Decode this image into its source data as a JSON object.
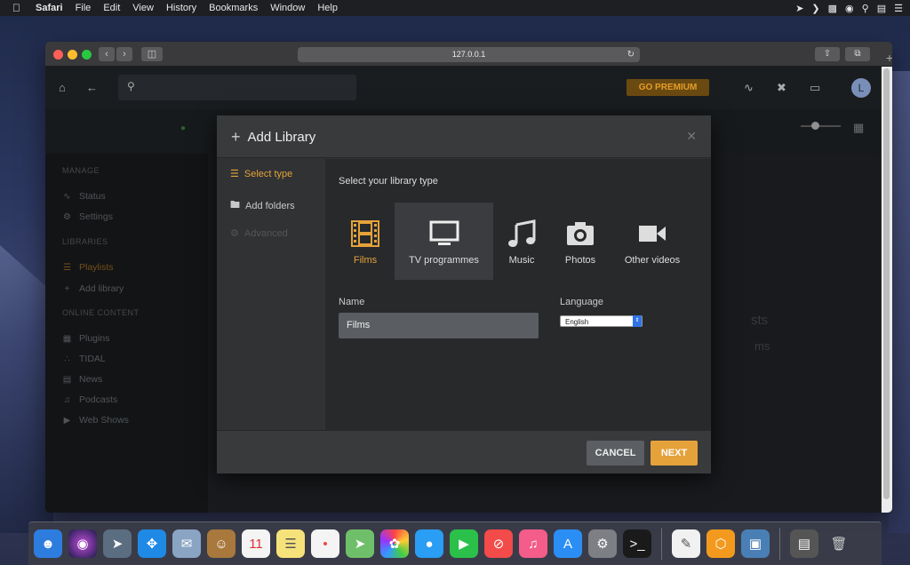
{
  "menubar": {
    "items": [
      "Safari",
      "File",
      "Edit",
      "View",
      "History",
      "Bookmarks",
      "Window",
      "Help"
    ]
  },
  "safari": {
    "url": "127.0.0.1"
  },
  "plex": {
    "premium_label": "GO PREMIUM",
    "avatar_initial": "L",
    "sidebar": {
      "manage_heading": "MANAGE",
      "status": "Status",
      "settings": "Settings",
      "libraries_heading": "LIBRARIES",
      "playlists": "Playlists",
      "add_library": "Add library",
      "online_heading": "ONLINE CONTENT",
      "plugins": "Plugins",
      "tidal": "TIDAL",
      "news": "News",
      "podcasts": "Podcasts",
      "web_shows": "Web Shows"
    },
    "bg_text_1": "sts",
    "bg_text_2": "ms"
  },
  "modal": {
    "title": "Add Library",
    "steps": {
      "select_type": "Select type",
      "add_folders": "Add folders",
      "advanced": "Advanced"
    },
    "heading": "Select your library type",
    "types": {
      "films": "Films",
      "tv": "TV programmes",
      "music": "Music",
      "photos": "Photos",
      "other": "Other videos"
    },
    "name_label": "Name",
    "name_value": "Films",
    "language_label": "Language",
    "language_value": "English",
    "cancel": "CANCEL",
    "next": "NEXT"
  },
  "colors": {
    "accent": "#e5a23a",
    "premium_bg": "#6b4a12"
  }
}
